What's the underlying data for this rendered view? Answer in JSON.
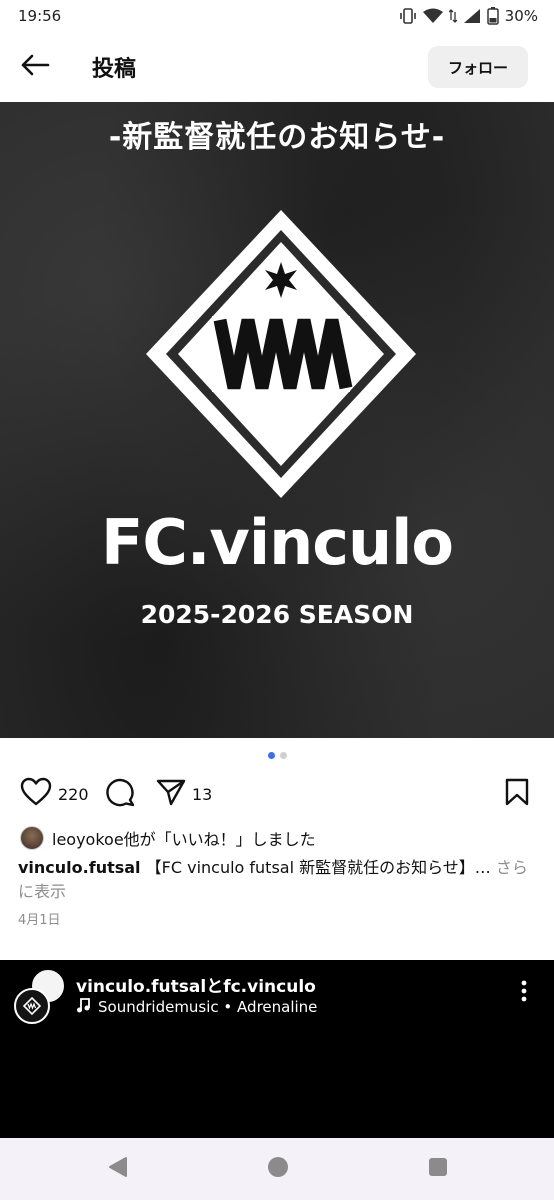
{
  "status_bar": {
    "time": "19:56",
    "battery_percent": "30%"
  },
  "header": {
    "title": "投稿",
    "follow_label": "フォロー"
  },
  "post_image": {
    "heading": "-新監督就任のお知らせ-",
    "club_name": "FC.vinculo",
    "season": "2025-2026 SEASON"
  },
  "carousel": {
    "count": 2,
    "active_index": 0,
    "active_color": "#3f6de8"
  },
  "actions": {
    "likes": "220",
    "shares": "13"
  },
  "likes_line": {
    "text": "leoyokoe他が「いいね！」しました"
  },
  "caption": {
    "username": "vinculo.futsal",
    "text": " 【FC vinculo futsal 新監督就任のお知らせ】…",
    "more": " さらに表示"
  },
  "post_date": "4月1日",
  "next_post": {
    "title": "vinculo.futsalとfc.vinculo",
    "music": "Soundridemusic • Adrenaline"
  },
  "icons": [
    "back-arrow-icon",
    "heart-icon",
    "comment-icon",
    "send-icon",
    "bookmark-icon",
    "music-note-icon",
    "more-vertical-icon"
  ]
}
